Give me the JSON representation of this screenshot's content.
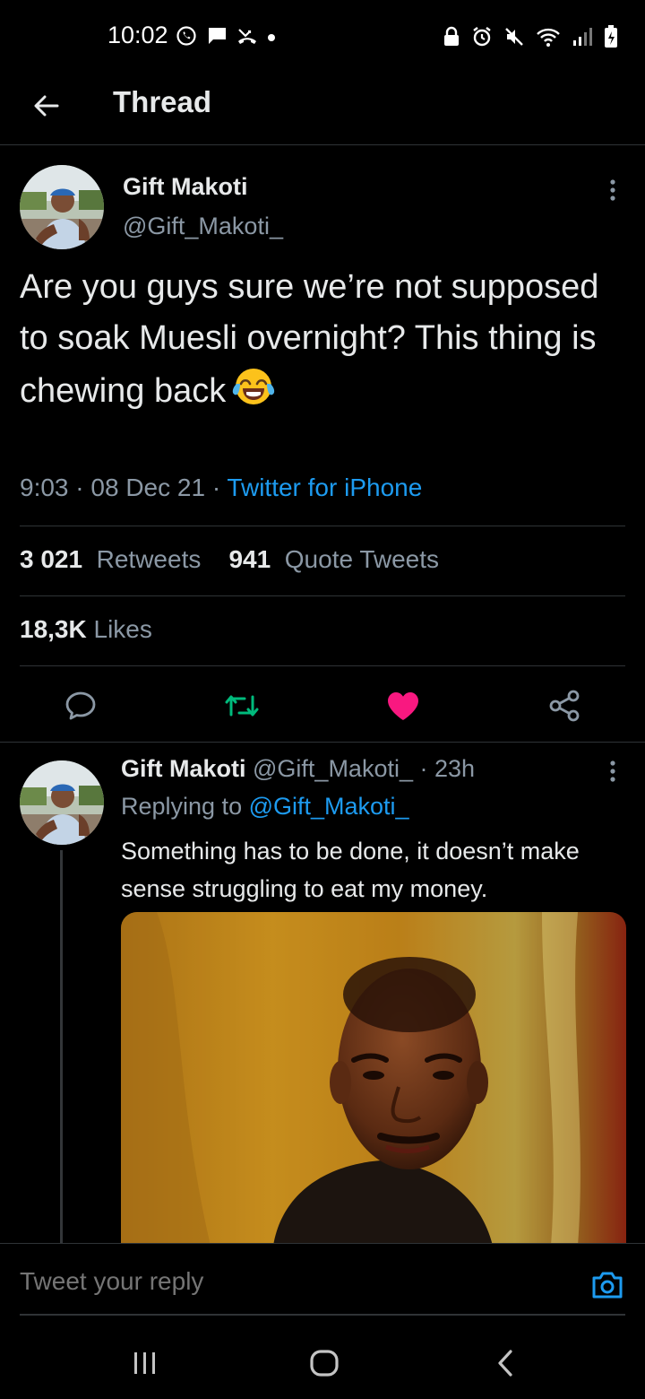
{
  "status_bar": {
    "time": "10:02",
    "left_icons": [
      "whatsapp-icon",
      "message-icon",
      "missed-call-icon",
      "dot-icon"
    ],
    "right_icons": [
      "lock-icon",
      "alarm-icon",
      "mute-icon",
      "wifi-icon",
      "signal-icon",
      "battery-icon"
    ]
  },
  "header": {
    "title": "Thread"
  },
  "tweet": {
    "author_name": "Gift Makoti",
    "handle": "@Gift_Makoti_",
    "text": "Are you guys sure we’re not supposed to soak Muesli overnight? This thing is chewing back",
    "emoji": "face-with-tears-of-joy",
    "time": "9:03",
    "separator": "·",
    "date": "08 Dec 21",
    "source": "Twitter for iPhone",
    "retweets_count": "3 021",
    "retweets_label": "Retweets",
    "quotes_count": "941",
    "quotes_label": "Quote Tweets",
    "likes_count": "18,3K",
    "likes_label": "Likes",
    "liked": true
  },
  "reply": {
    "author_name": "Gift Makoti",
    "handle": "@Gift_Makoti_",
    "dot": "·",
    "age": "23h",
    "replying_prefix": "Replying to",
    "replying_to": "@Gift_Makoti_",
    "text": "Something has to be done, it doesn’t make sense struggling to eat my money."
  },
  "compose": {
    "placeholder": "Tweet your reply"
  },
  "colors": {
    "accent": "#1d9bf0",
    "like": "#f91880",
    "retweet": "#00ba7c",
    "secondary_text": "#8b98a5",
    "background": "#000000"
  }
}
